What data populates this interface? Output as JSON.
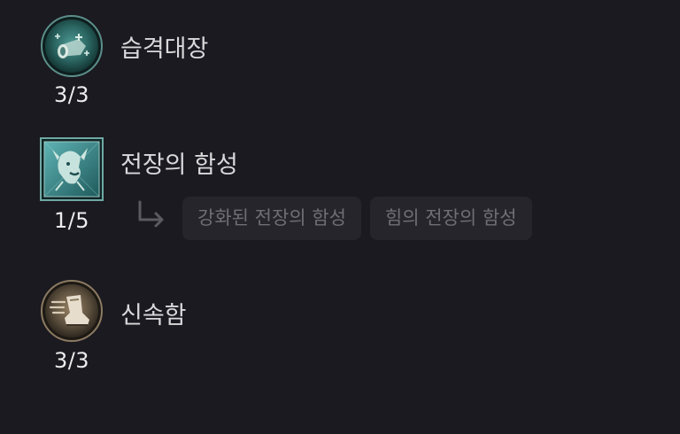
{
  "skills": [
    {
      "name": "습격대장",
      "rank": "3/3",
      "icon": "charge-horn-icon",
      "frame": "round-teal"
    },
    {
      "name": "전장의 함성",
      "rank": "1/5",
      "icon": "war-cry-icon",
      "frame": "square-teal"
    },
    {
      "name": "신속함",
      "rank": "3/3",
      "icon": "swift-boot-icon",
      "frame": "round-bronze"
    }
  ],
  "modifiers": [
    {
      "label": "강화된 전장의 함성"
    },
    {
      "label": "힘의 전장의 함성"
    }
  ],
  "colors": {
    "background": "#1b1a20",
    "chip_background": "#25252b",
    "chip_text": "#6f6e75",
    "text": "#d9d9dc"
  }
}
